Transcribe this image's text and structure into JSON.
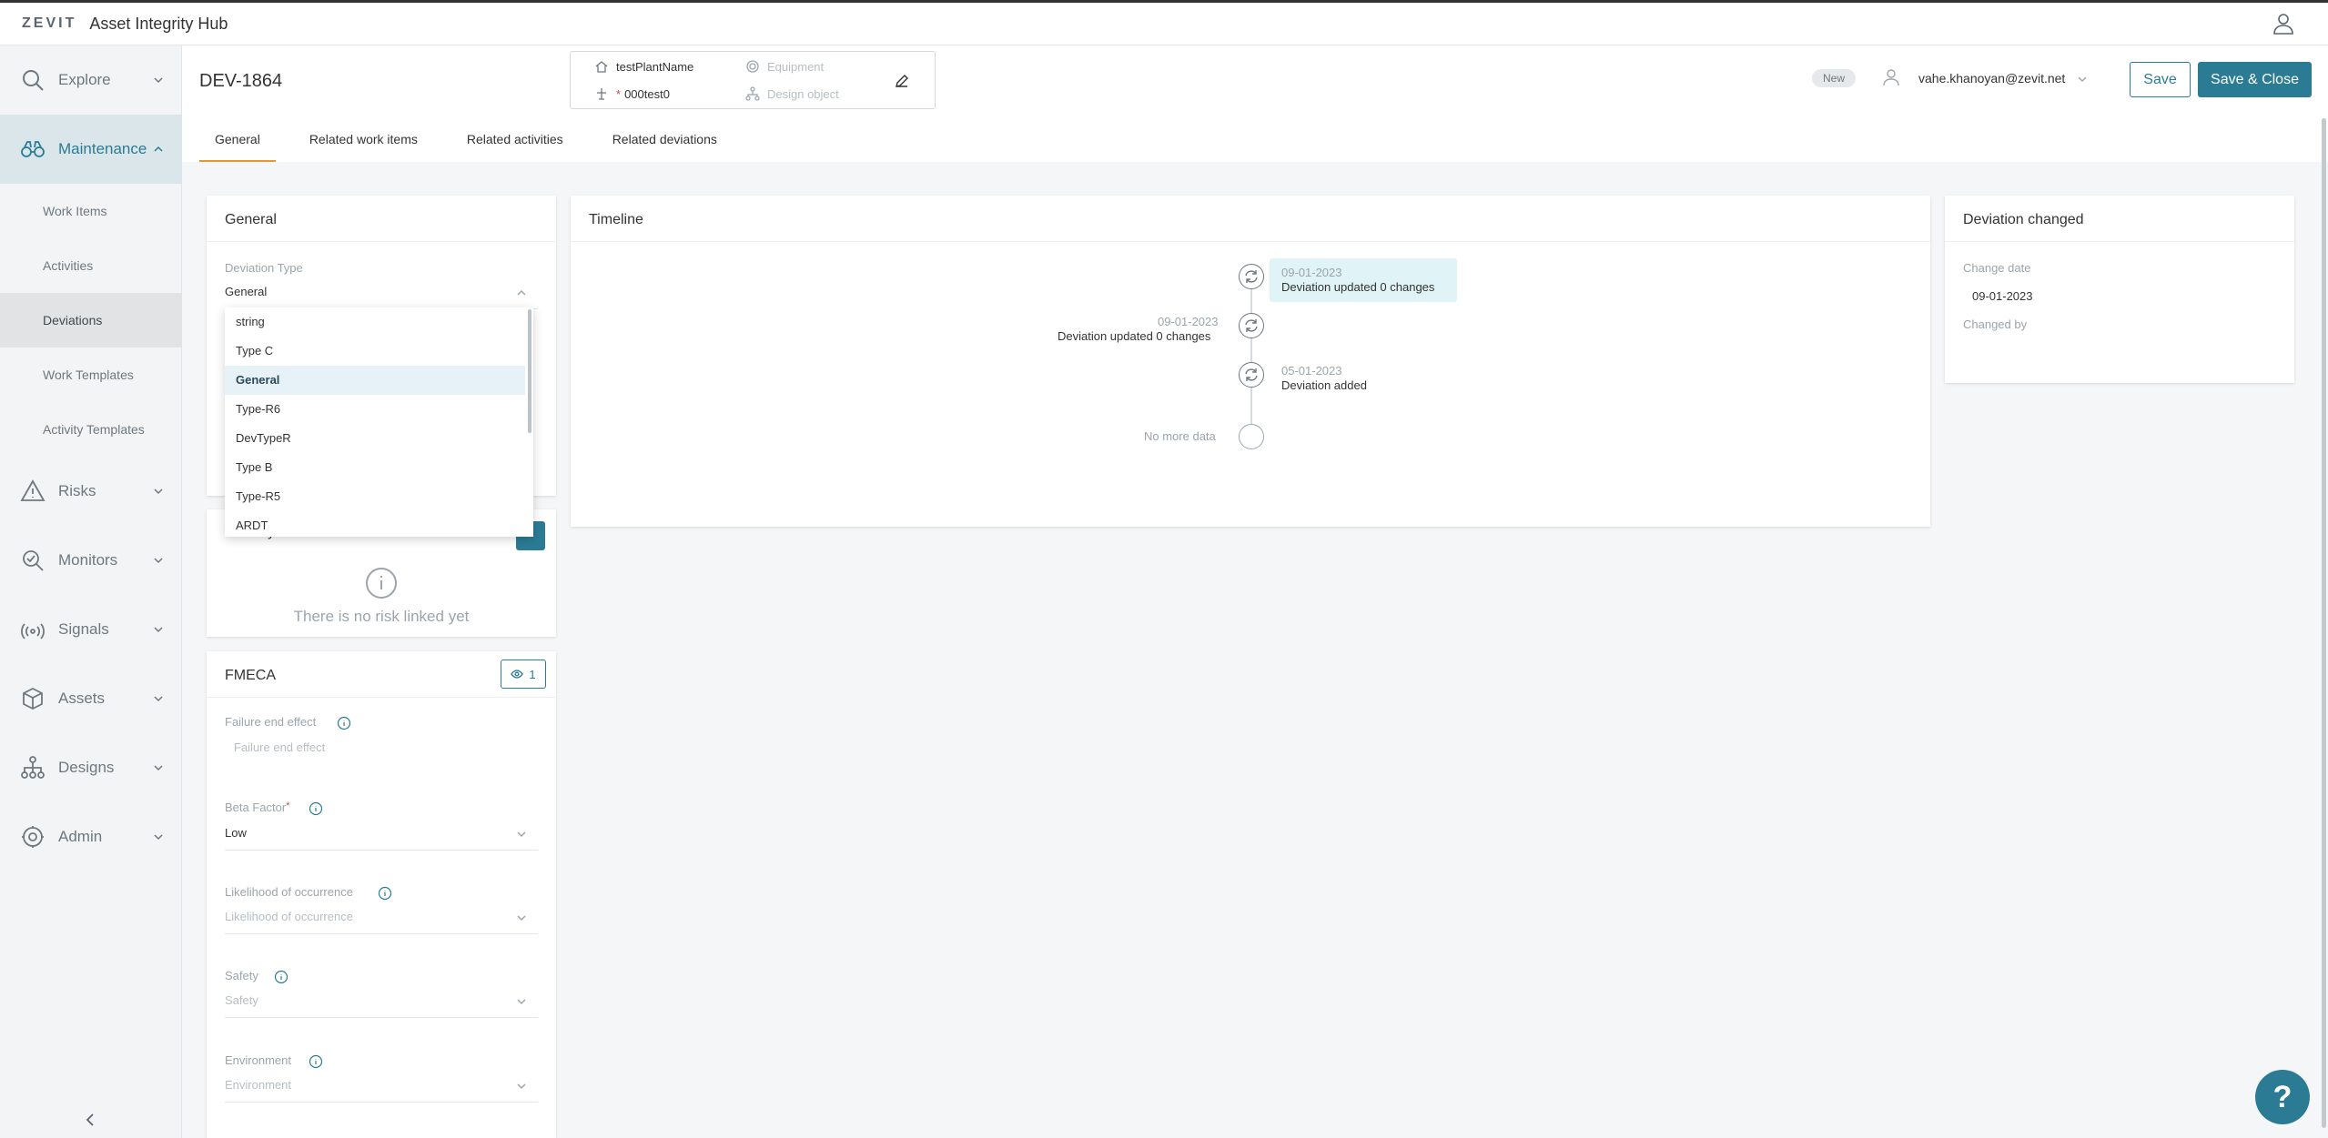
{
  "app": {
    "brand": "ZEVIT",
    "title": "Asset Integrity Hub"
  },
  "sidebar": {
    "items": [
      {
        "label": "Explore"
      },
      {
        "label": "Maintenance"
      },
      {
        "label": "Risks"
      },
      {
        "label": "Monitors"
      },
      {
        "label": "Signals"
      },
      {
        "label": "Assets"
      },
      {
        "label": "Designs"
      },
      {
        "label": "Admin"
      }
    ],
    "maintenance_sub": [
      {
        "label": "Work Items"
      },
      {
        "label": "Activities"
      },
      {
        "label": "Deviations"
      },
      {
        "label": "Work Templates"
      },
      {
        "label": "Activity Templates"
      }
    ]
  },
  "header": {
    "id": "DEV-1864",
    "context": {
      "plant": "testPlantName",
      "equipment_placeholder": "Equipment",
      "system": "000test0",
      "design_placeholder": "Design object"
    },
    "status_badge": "New",
    "user_email": "vahe.khanoyan@zevit.net",
    "save_label": "Save",
    "save_close_label": "Save & Close"
  },
  "tabs": [
    {
      "label": "General"
    },
    {
      "label": "Related work items"
    },
    {
      "label": "Related activities"
    },
    {
      "label": "Related deviations"
    }
  ],
  "general_card": {
    "title": "General",
    "deviation_type_label": "Deviation Type",
    "deviation_type_value": "General",
    "dropdown_options": [
      "string",
      "Type C",
      "General",
      "Type-R6",
      "DevTypeR",
      "Type B",
      "Type-R5",
      "ARDT"
    ]
  },
  "risk_card": {
    "title_partial": "Primary Risk",
    "empty_text": "There is no risk linked yet"
  },
  "fmeca_card": {
    "title": "FMECA",
    "view_count": "1",
    "failure_end_effect_label": "Failure end effect",
    "failure_end_effect_placeholder": "Failure end effect",
    "beta_factor_label": "Beta Factor",
    "beta_factor_value": "Low",
    "likelihood_label": "Likelihood of occurrence",
    "likelihood_placeholder": "Likelihood of occurrence",
    "safety_label": "Safety",
    "safety_placeholder": "Safety",
    "environment_label": "Environment",
    "environment_placeholder": "Environment"
  },
  "timeline": {
    "title": "Timeline",
    "entries": [
      {
        "date": "09-01-2023",
        "text": "Deviation updated 0 changes"
      },
      {
        "date": "09-01-2023",
        "text": "Deviation updated 0 changes"
      },
      {
        "date": "05-01-2023",
        "text": "Deviation added"
      }
    ],
    "no_more": "No more data"
  },
  "changed_card": {
    "title": "Deviation changed",
    "change_date_label": "Change date",
    "change_date_value": "09-01-2023",
    "changed_by_label": "Changed by"
  },
  "help_label": "?",
  "colors": {
    "accent": "#2b7b95",
    "tab_indicator": "#e09a3d",
    "highlight": "#e0f3f6"
  }
}
